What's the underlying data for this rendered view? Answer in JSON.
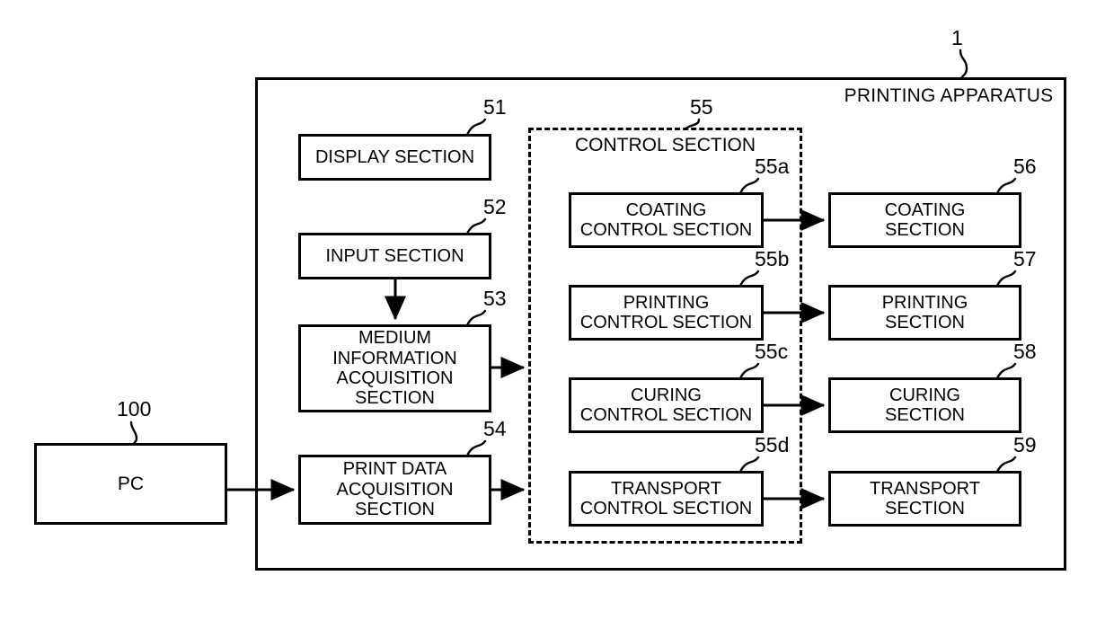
{
  "figure": {
    "apparatus_label": "PRINTING APPARATUS",
    "apparatus_ref": "1",
    "control_section_label": "CONTROL SECTION",
    "control_section_ref": "55"
  },
  "nodes": {
    "pc": {
      "label": "PC",
      "ref": "100"
    },
    "display": {
      "label": "DISPLAY SECTION",
      "ref": "51"
    },
    "input": {
      "label": "INPUT SECTION",
      "ref": "52"
    },
    "medium": {
      "label": "MEDIUM\nINFORMATION\nACQUISITION\nSECTION",
      "ref": "53"
    },
    "printdata": {
      "label": "PRINT DATA\nACQUISITION\nSECTION",
      "ref": "54"
    },
    "coating_ctrl": {
      "label": "COATING\nCONTROL SECTION",
      "ref": "55a"
    },
    "printing_ctrl": {
      "label": "PRINTING\nCONTROL SECTION",
      "ref": "55b"
    },
    "curing_ctrl": {
      "label": "CURING\nCONTROL SECTION",
      "ref": "55c"
    },
    "transport_ctrl": {
      "label": "TRANSPORT\nCONTROL SECTION",
      "ref": "55d"
    },
    "coating": {
      "label": "COATING\nSECTION",
      "ref": "56"
    },
    "printing": {
      "label": "PRINTING\nSECTION",
      "ref": "57"
    },
    "curing": {
      "label": "CURING\nSECTION",
      "ref": "58"
    },
    "transport": {
      "label": "TRANSPORT\nSECTION",
      "ref": "59"
    }
  },
  "colors": {
    "stroke": "#000000",
    "background": "#ffffff"
  }
}
